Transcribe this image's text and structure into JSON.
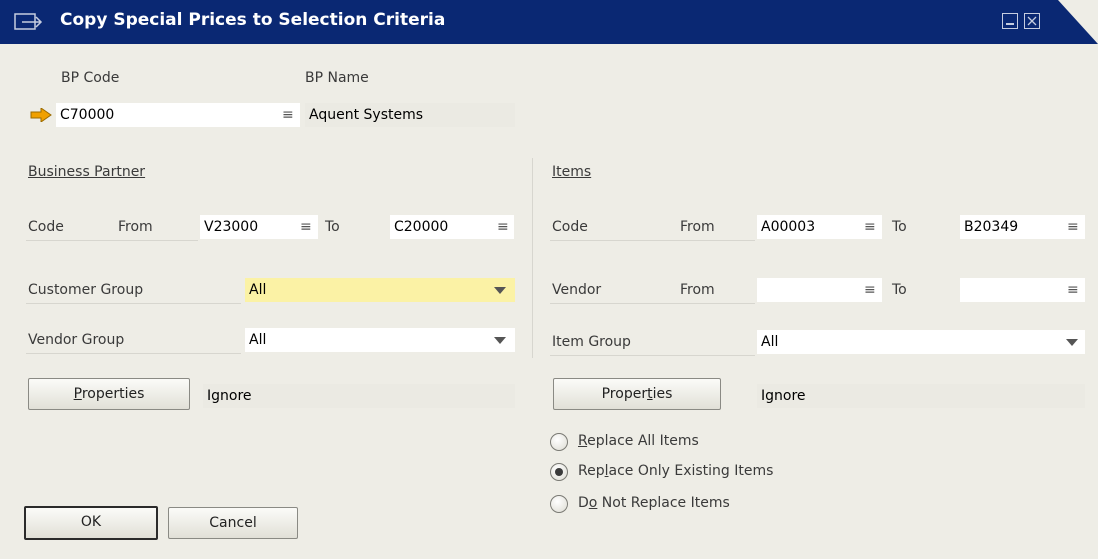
{
  "window": {
    "title": "Copy Special Prices to Selection Criteria"
  },
  "bp": {
    "code_label": "BP Code",
    "name_label": "BP Name",
    "code_value": "C70000",
    "name_value": "Aquent Systems"
  },
  "business_partner": {
    "header": "Business Partner",
    "code_label": "Code",
    "from_label": "From",
    "code_from": "V23000",
    "to_label": "To",
    "code_to": "C20000",
    "customer_group_label": "Customer Group",
    "customer_group_value": "All",
    "vendor_group_label": "Vendor Group",
    "vendor_group_value": "All",
    "properties_button": {
      "pre": "",
      "mnemonic": "P",
      "post": "roperties"
    },
    "properties_value": "Ignore"
  },
  "items": {
    "header": "Items",
    "code_label": "Code",
    "from_label": "From",
    "code_from": "A00003",
    "to_label": "To",
    "code_to": "B20349",
    "vendor_label": "Vendor",
    "vendor_from_label": "From",
    "vendor_from": "",
    "vendor_to_label": "To",
    "vendor_to": "",
    "item_group_label": "Item Group",
    "item_group_value": "All",
    "properties_button": {
      "pre": "Proper",
      "mnemonic": "t",
      "post": "ies"
    },
    "properties_value": "Ignore"
  },
  "replace_options": [
    {
      "pre": "",
      "mnemonic": "R",
      "post": "eplace All Items",
      "selected": false
    },
    {
      "pre": "Rep",
      "mnemonic": "l",
      "post": "ace Only Existing Items",
      "selected": true
    },
    {
      "pre": "D",
      "mnemonic": "o",
      "post": " Not Replace Items",
      "selected": false
    }
  ],
  "buttons": {
    "ok": "OK",
    "cancel": "Cancel"
  },
  "glyphs": {
    "choose_from_list": "≡",
    "arrow_icon": "orange-right-arrow-icon"
  },
  "colors": {
    "titlebar": "#0a2873",
    "mandatory_field": "#fbf2a5",
    "arrow": "#f0a000"
  }
}
